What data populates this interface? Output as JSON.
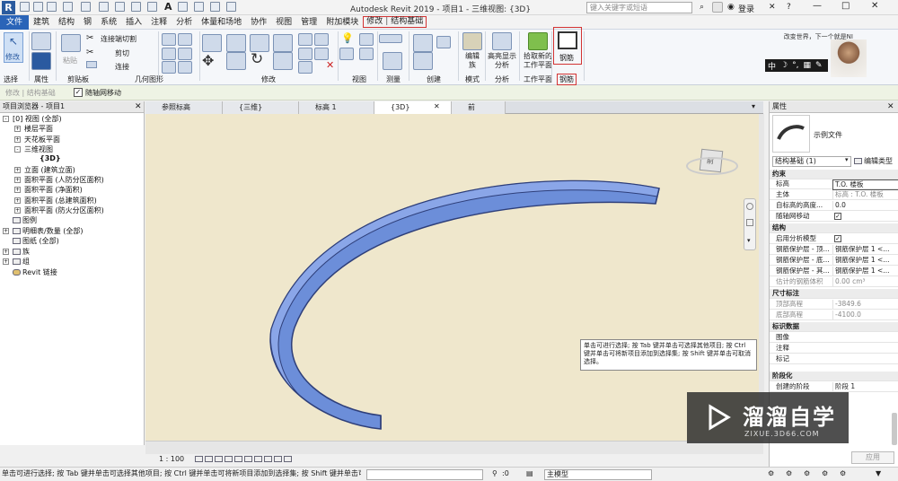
{
  "title_bar": {
    "app_title": "Autodesk Revit 2019 - 项目1 - 三维视图: {3D}",
    "search_placeholder": "键入关键字或短语",
    "user": "登录"
  },
  "menu": {
    "items": [
      "文件",
      "建筑",
      "结构",
      "钢",
      "系统",
      "插入",
      "注释",
      "分析",
      "体量和场地",
      "协作",
      "视图",
      "管理",
      "附加模块"
    ],
    "ctx_tabs": [
      "修改",
      "结构基础"
    ]
  },
  "ribbon": {
    "modify_btn": "修改",
    "panels": [
      "选择",
      "属性",
      "剪贴板",
      "几何图形",
      "修改",
      "视图",
      "测量",
      "创建",
      "模式",
      "分析",
      "工作平面",
      "钢筋"
    ],
    "join_cut": "连接端切割",
    "cut": "剪切",
    "join": "连接",
    "paste": "粘贴",
    "edit_family": "编辑族",
    "highlight": "高亮显示分析",
    "pick_plane": "拾取新的工作平面",
    "rebar": "钢筋",
    "user_tip": "改变世界，下一个就是NI",
    "ime": "中"
  },
  "options_bar": {
    "context": "修改 | 结构基础",
    "option": "随轴网移动"
  },
  "project_browser": {
    "title": "项目浏览器 - 项目1",
    "items": [
      "[0] 视图 (全部)",
      "楼层平面",
      "天花板平面",
      "三维视图",
      "{3D}",
      "立面 (建筑立面)",
      "面积平面 (人防分区面积)",
      "面积平面 (净面积)",
      "面积平面 (总建筑面积)",
      "面积平面 (防火分区面积)",
      "图例",
      "明细表/数量 (全部)",
      "图纸 (全部)",
      "族",
      "组",
      "Revit 链接"
    ]
  },
  "view_tabs": [
    "参照标高",
    "{三维}",
    "标高 1",
    "{3D}",
    "前"
  ],
  "viewport": {
    "tooltip": "单击可进行选择; 按 Tab 键并单击可选择其他项目; 按 Ctrl 键并单击可将新项目添加到选择集; 按 Shift 键并单击可取消选择。",
    "viewcube_label": "前"
  },
  "view_bar": {
    "scale": "1 : 100"
  },
  "properties": {
    "title": "属性",
    "type_name": "示例文件",
    "filter": "结构基础 (1)",
    "edit_type": "编辑类型",
    "groups": {
      "constraints": "约束",
      "structure": "结构",
      "dimensions": "尺寸标注",
      "identity": "标识数据",
      "phasing": "阶段化"
    },
    "rows": {
      "level": [
        "标高",
        "T.O. 楼板"
      ],
      "host": [
        "主体",
        "标高 : T.O. 楼板"
      ],
      "offset": [
        "自标高的高度...",
        "0.0"
      ],
      "move_grid": [
        "随轴网移动",
        ""
      ],
      "analytical": [
        "启用分析模型",
        ""
      ],
      "cover_top": [
        "钢筋保护层 - 顶...",
        "钢筋保护层 1 <..."
      ],
      "cover_bot": [
        "钢筋保护层 - 底...",
        "钢筋保护层 1 <..."
      ],
      "cover_other": [
        "钢筋保护层 - 其...",
        "钢筋保护层 1 <..."
      ],
      "rebar_vol": [
        "估计的钢筋体积",
        "0.00 cm³"
      ],
      "top_elev": [
        "顶部高程",
        "-3849.6"
      ],
      "bot_elev": [
        "底部高程",
        "-4100.0"
      ],
      "image": [
        "图像",
        ""
      ],
      "comments": [
        "注释",
        ""
      ],
      "mark": [
        "标记",
        ""
      ],
      "phase": [
        "创建的阶段",
        "阶段 1"
      ]
    },
    "apply": "应用"
  },
  "status": {
    "text": "单击可进行选择; 按 Tab 键并单击可选择其他项目; 按 Ctrl 键并单击可将新项目添加到选择集; 按 Shift 键并单击可",
    "zero": ":0",
    "model": "主模型"
  },
  "watermark": {
    "brand": "溜溜自学",
    "url": "ZIXUE.3D66.COM"
  }
}
